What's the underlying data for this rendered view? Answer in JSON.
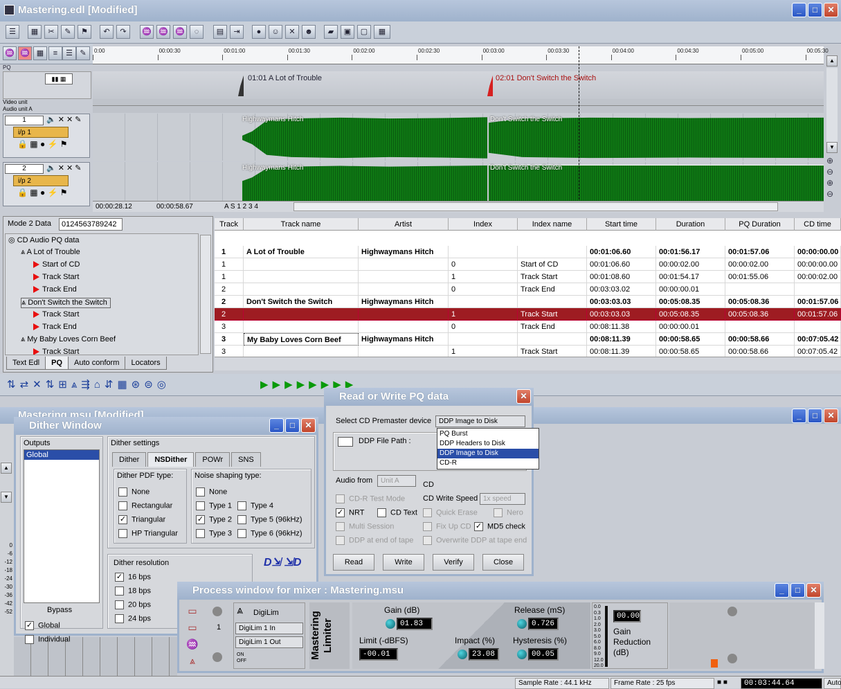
{
  "app": {
    "title": "Mastering.edl [Modified]"
  },
  "ruler": {
    "ticks": [
      "0:00",
      "00:00:30",
      "00:01:00",
      "00:01:30",
      "00:02:00",
      "00:02:30",
      "00:03:00",
      "00:03:30",
      "00:04:00",
      "00:04:30",
      "00:05:00",
      "00:05:30"
    ]
  },
  "lanes": {
    "pq": "PQ",
    "video": "Video unit",
    "audioA": "Audio unit A"
  },
  "markers": [
    {
      "label": "01:01  A Lot of Trouble"
    },
    {
      "label": "02:01  Don't Switch the Switch"
    }
  ],
  "tracks": [
    {
      "num": "1",
      "input": "i/p 1",
      "clips": [
        "Highwaymans Hitch",
        "Don't Switch the Switch"
      ]
    },
    {
      "num": "2",
      "input": "i/p 2",
      "clips": [
        "Highwaymans Hitch",
        "Don't Switch the Switch"
      ]
    }
  ],
  "timeline_footer": {
    "t1": "00:00:28.12",
    "t2": "00:00:58.67",
    "pos": "A S 1 2 3 4"
  },
  "pq_panel": {
    "mode_label": "Mode 2 Data",
    "mode_value": "0124563789242",
    "tree": [
      "CD Audio PQ data",
      "A Lot of Trouble",
      "Start of CD",
      "Track Start",
      "Track End",
      "Don't Switch the Switch",
      "Track Start",
      "Track End",
      "My Baby Loves Corn Beef",
      "Track Start"
    ],
    "tabs": [
      "Text Edl",
      "PQ",
      "Auto conform",
      "Locators"
    ]
  },
  "grid": {
    "headers": [
      "Track",
      "Track name",
      "Artist",
      "Index",
      "Index name",
      "Start time",
      "Duration",
      "PQ Duration",
      "CD time"
    ],
    "rows": [
      [
        "1",
        "A Lot of Trouble",
        "Highwaymans Hitch",
        "",
        "",
        "00:01:06.60",
        "00:01:56.17",
        "00:01:57.06",
        "00:00:00.00"
      ],
      [
        "1",
        "",
        "",
        "0",
        "Start of CD",
        "00:01:06.60",
        "00:00:02.00",
        "00:00:02.00",
        "00:00:00.00"
      ],
      [
        "1",
        "",
        "",
        "1",
        "Track Start",
        "00:01:08.60",
        "00:01:54.17",
        "00:01:55.06",
        "00:00:02.00"
      ],
      [
        "2",
        "",
        "",
        "0",
        "Track End",
        "00:03:03.02",
        "00:00:00.01",
        "",
        ""
      ],
      [
        "2",
        "Don't Switch the Switch",
        "Highwaymans Hitch",
        "",
        "",
        "00:03:03.03",
        "00:05:08.35",
        "00:05:08.36",
        "00:01:57.06"
      ],
      [
        "2",
        "",
        "",
        "1",
        "Track Start",
        "00:03:03.03",
        "00:05:08.35",
        "00:05:08.36",
        "00:01:57.06"
      ],
      [
        "3",
        "",
        "",
        "0",
        "Track End",
        "00:08:11.38",
        "00:00:00.01",
        "",
        ""
      ],
      [
        "3",
        "My Baby Loves Corn Beef",
        "Highwaymans Hitch",
        "",
        "",
        "00:08:11.39",
        "00:00:58.65",
        "00:00:58.66",
        "00:07:05.42"
      ],
      [
        "3",
        "",
        "",
        "1",
        "",
        "00:08:11.39",
        "00:00:58.65",
        "00:00:58.66",
        "00:07:05.42"
      ]
    ],
    "row_index_name_last": "Track Start"
  },
  "msu": {
    "title": "Mastering.msu [Modified]"
  },
  "dither": {
    "title": "Dither Window",
    "outputs_label": "Outputs",
    "outputs": [
      "Global"
    ],
    "bypass": "Bypass",
    "global": "Global",
    "individual": "Individual",
    "settings_label": "Dither settings",
    "tabs": [
      "Dither",
      "NSDither",
      "POWr",
      "SNS"
    ],
    "pdf_label": "Dither PDF type:",
    "pdf": [
      "None",
      "Rectangular",
      "Triangular",
      "HP Triangular"
    ],
    "ns_label": "Noise shaping type:",
    "ns1": [
      "None",
      "Type 1",
      "Type 2",
      "Type 3"
    ],
    "ns2": [
      "Type 4",
      "Type 5 (96kHz)",
      "Type 6 (96kHz)"
    ],
    "res_label": "Dither resolution",
    "res": [
      "16 bps",
      "18 bps",
      "20 bps",
      "24 bps"
    ]
  },
  "pqdlg": {
    "title": "Read or Write PQ data",
    "device_label": "Select CD Premaster device",
    "device_value": "DDP Image to Disk",
    "options": [
      "PQ Burst",
      "DDP Headers to Disk",
      "DDP Image to Disk",
      "CD-R"
    ],
    "path_label": "DDP File Path :",
    "audio_from": "Audio from",
    "unit": "Unit A",
    "cd": "CD",
    "write_speed": "CD Write Speed",
    "speed": "1x speed",
    "checks": {
      "cdr_test": "CD-R Test Mode",
      "nrt": "NRT",
      "cd_text": "CD Text",
      "quick_erase": "Quick Erase",
      "nero": "Nero",
      "multi": "Multi Session",
      "fixup": "Fix Up CD",
      "md5": "MD5 check",
      "ddp_end": "DDP at end of tape",
      "overwrite": "Overwrite DDP at tape end"
    },
    "buttons": [
      "Read",
      "Write",
      "Verify",
      "Close"
    ]
  },
  "process": {
    "title": "Process window for mixer : Mastering.msu",
    "plugin": "DigiLim",
    "num": "1",
    "in": "DigiLim 1 In",
    "out": "DigiLim 1 Out",
    "on": "ON",
    "off": "OFF",
    "brand": "Mastering Limiter",
    "gain_label": "Gain (dB)",
    "gain": "01.83",
    "limit_label": "Limit (-dBFS)",
    "limit": "-00.01",
    "impact_label": "Impact (%)",
    "impact": "23.08",
    "release_label": "Release (mS)",
    "release": "0.726",
    "hyst_label": "Hysteresis (%)",
    "hyst": "00.05",
    "meter_scale": [
      "0.0",
      "0.3",
      "1.0",
      "2.0",
      "3.0",
      "5.0",
      "6.0",
      "8.0",
      "9.0",
      "12.0",
      "20.0"
    ],
    "gr_value": "00.00",
    "gr_label": "Gain Reduction (dB)"
  },
  "scale_left": [
    "0",
    "-6",
    "-12",
    "-18",
    "-24",
    "-30",
    "-36",
    "-42",
    "-52"
  ],
  "status": {
    "sample_rate": "Sample Rate :  44.1 kHz",
    "frame_rate": "Frame Rate :  25 fps",
    "time": "00:03:44.64",
    "auto": "Auto"
  }
}
